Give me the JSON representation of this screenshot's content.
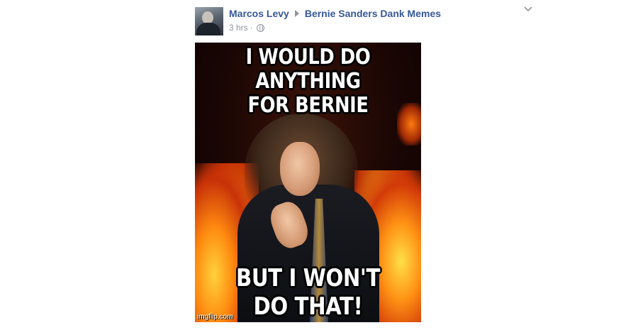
{
  "post": {
    "author": "Marcos Levy",
    "group": "Bernie Sanders Dank Memes",
    "time": "3 hrs",
    "dot": "·",
    "privacy_icon": "globe-icon",
    "options_icon": "chevron-down-icon"
  },
  "meme": {
    "top_line_1": "I WOULD DO ANYTHING",
    "top_line_2": "FOR BERNIE",
    "bottom_line_1": "BUT I WON'T",
    "bottom_line_2": "DO THAT!",
    "watermark": "imgflip.com"
  },
  "colors": {
    "link": "#365899",
    "meta": "#90949c"
  }
}
